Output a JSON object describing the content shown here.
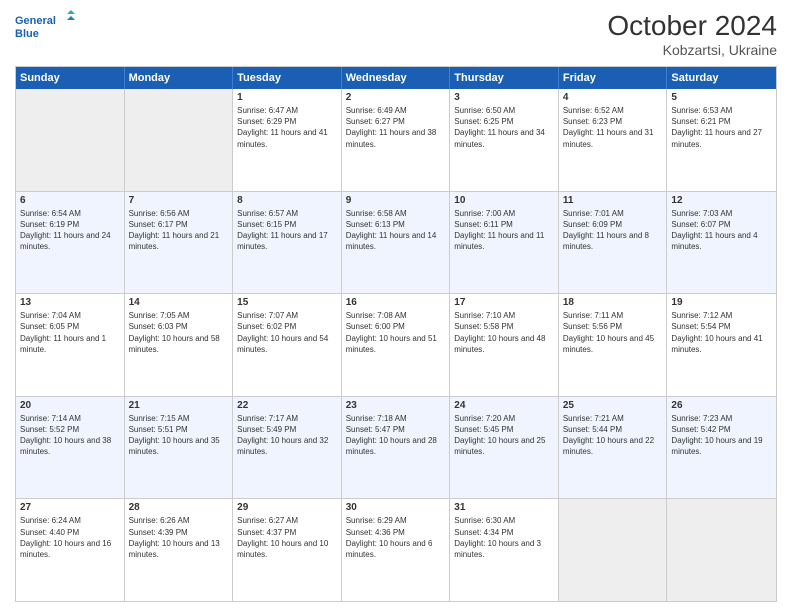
{
  "header": {
    "logo_line1": "General",
    "logo_line2": "Blue",
    "month_year": "October 2024",
    "location": "Kobzartsi, Ukraine"
  },
  "days_of_week": [
    "Sunday",
    "Monday",
    "Tuesday",
    "Wednesday",
    "Thursday",
    "Friday",
    "Saturday"
  ],
  "weeks": [
    [
      {
        "day": "",
        "empty": true
      },
      {
        "day": "",
        "empty": true
      },
      {
        "day": "1",
        "sunrise": "6:47 AM",
        "sunset": "6:29 PM",
        "daylight": "11 hours and 41 minutes."
      },
      {
        "day": "2",
        "sunrise": "6:49 AM",
        "sunset": "6:27 PM",
        "daylight": "11 hours and 38 minutes."
      },
      {
        "day": "3",
        "sunrise": "6:50 AM",
        "sunset": "6:25 PM",
        "daylight": "11 hours and 34 minutes."
      },
      {
        "day": "4",
        "sunrise": "6:52 AM",
        "sunset": "6:23 PM",
        "daylight": "11 hours and 31 minutes."
      },
      {
        "day": "5",
        "sunrise": "6:53 AM",
        "sunset": "6:21 PM",
        "daylight": "11 hours and 27 minutes."
      }
    ],
    [
      {
        "day": "6",
        "sunrise": "6:54 AM",
        "sunset": "6:19 PM",
        "daylight": "11 hours and 24 minutes."
      },
      {
        "day": "7",
        "sunrise": "6:56 AM",
        "sunset": "6:17 PM",
        "daylight": "11 hours and 21 minutes."
      },
      {
        "day": "8",
        "sunrise": "6:57 AM",
        "sunset": "6:15 PM",
        "daylight": "11 hours and 17 minutes."
      },
      {
        "day": "9",
        "sunrise": "6:58 AM",
        "sunset": "6:13 PM",
        "daylight": "11 hours and 14 minutes."
      },
      {
        "day": "10",
        "sunrise": "7:00 AM",
        "sunset": "6:11 PM",
        "daylight": "11 hours and 11 minutes."
      },
      {
        "day": "11",
        "sunrise": "7:01 AM",
        "sunset": "6:09 PM",
        "daylight": "11 hours and 8 minutes."
      },
      {
        "day": "12",
        "sunrise": "7:03 AM",
        "sunset": "6:07 PM",
        "daylight": "11 hours and 4 minutes."
      }
    ],
    [
      {
        "day": "13",
        "sunrise": "7:04 AM",
        "sunset": "6:05 PM",
        "daylight": "11 hours and 1 minute."
      },
      {
        "day": "14",
        "sunrise": "7:05 AM",
        "sunset": "6:03 PM",
        "daylight": "10 hours and 58 minutes."
      },
      {
        "day": "15",
        "sunrise": "7:07 AM",
        "sunset": "6:02 PM",
        "daylight": "10 hours and 54 minutes."
      },
      {
        "day": "16",
        "sunrise": "7:08 AM",
        "sunset": "6:00 PM",
        "daylight": "10 hours and 51 minutes."
      },
      {
        "day": "17",
        "sunrise": "7:10 AM",
        "sunset": "5:58 PM",
        "daylight": "10 hours and 48 minutes."
      },
      {
        "day": "18",
        "sunrise": "7:11 AM",
        "sunset": "5:56 PM",
        "daylight": "10 hours and 45 minutes."
      },
      {
        "day": "19",
        "sunrise": "7:12 AM",
        "sunset": "5:54 PM",
        "daylight": "10 hours and 41 minutes."
      }
    ],
    [
      {
        "day": "20",
        "sunrise": "7:14 AM",
        "sunset": "5:52 PM",
        "daylight": "10 hours and 38 minutes."
      },
      {
        "day": "21",
        "sunrise": "7:15 AM",
        "sunset": "5:51 PM",
        "daylight": "10 hours and 35 minutes."
      },
      {
        "day": "22",
        "sunrise": "7:17 AM",
        "sunset": "5:49 PM",
        "daylight": "10 hours and 32 minutes."
      },
      {
        "day": "23",
        "sunrise": "7:18 AM",
        "sunset": "5:47 PM",
        "daylight": "10 hours and 28 minutes."
      },
      {
        "day": "24",
        "sunrise": "7:20 AM",
        "sunset": "5:45 PM",
        "daylight": "10 hours and 25 minutes."
      },
      {
        "day": "25",
        "sunrise": "7:21 AM",
        "sunset": "5:44 PM",
        "daylight": "10 hours and 22 minutes."
      },
      {
        "day": "26",
        "sunrise": "7:23 AM",
        "sunset": "5:42 PM",
        "daylight": "10 hours and 19 minutes."
      }
    ],
    [
      {
        "day": "27",
        "sunrise": "6:24 AM",
        "sunset": "4:40 PM",
        "daylight": "10 hours and 16 minutes."
      },
      {
        "day": "28",
        "sunrise": "6:26 AM",
        "sunset": "4:39 PM",
        "daylight": "10 hours and 13 minutes."
      },
      {
        "day": "29",
        "sunrise": "6:27 AM",
        "sunset": "4:37 PM",
        "daylight": "10 hours and 10 minutes."
      },
      {
        "day": "30",
        "sunrise": "6:29 AM",
        "sunset": "4:36 PM",
        "daylight": "10 hours and 6 minutes."
      },
      {
        "day": "31",
        "sunrise": "6:30 AM",
        "sunset": "4:34 PM",
        "daylight": "10 hours and 3 minutes."
      },
      {
        "day": "",
        "empty": true
      },
      {
        "day": "",
        "empty": true
      }
    ]
  ],
  "labels": {
    "sunrise": "Sunrise:",
    "sunset": "Sunset:",
    "daylight": "Daylight:"
  }
}
